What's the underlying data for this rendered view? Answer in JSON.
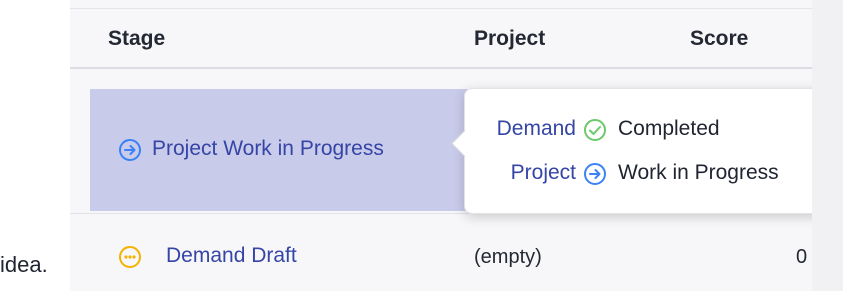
{
  "table": {
    "columns": [
      {
        "label": "Stage"
      },
      {
        "label": "Project"
      },
      {
        "label": "Score"
      }
    ],
    "rows": [
      {
        "stage_label": "Project Work in Progress",
        "stage_icon": "arrow-circle-right-icon",
        "project": "",
        "score": ""
      },
      {
        "stage_label": "Demand Draft",
        "stage_icon": "dots-circle-icon",
        "project": "(empty)",
        "score": "0"
      }
    ]
  },
  "popup": {
    "items": [
      {
        "link": "Demand",
        "status_icon": "check-circle-icon",
        "status": "Completed"
      },
      {
        "link": "Project",
        "status_icon": "arrow-circle-right-icon",
        "status": "Work in Progress"
      }
    ]
  },
  "footer_fragment": "idea.",
  "colors": {
    "link": "#3545a6",
    "highlight_row": "#c9cbea",
    "check_green": "#6cc96c",
    "arrow_blue": "#3b82f6",
    "draft_orange": "#f3b300"
  }
}
